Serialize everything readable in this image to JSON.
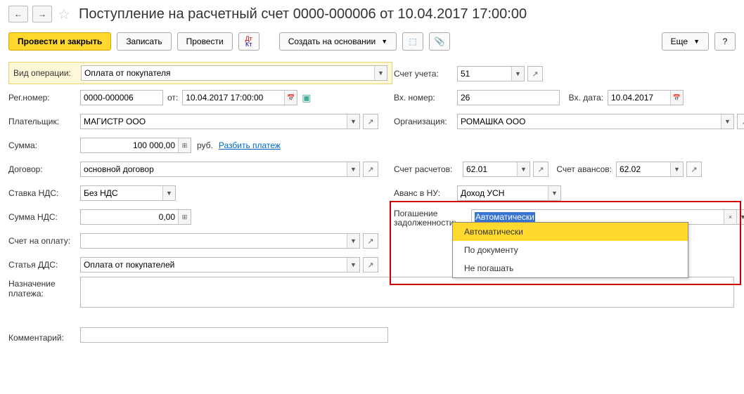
{
  "header": {
    "title": "Поступление на расчетный счет 0000-000006 от 10.04.2017 17:00:00"
  },
  "toolbar": {
    "post_close": "Провести и закрыть",
    "save": "Записать",
    "post": "Провести",
    "create_basis": "Создать на основании",
    "more": "Еще"
  },
  "labels": {
    "vid_op": "Вид операции:",
    "schet_ucheta": "Счет учета:",
    "reg_nomer": "Рег.номер:",
    "ot": "от:",
    "vh_nomer": "Вх. номер:",
    "vh_data": "Вх. дата:",
    "platelshik": "Плательщик:",
    "organizaciya": "Организация:",
    "summa": "Сумма:",
    "rub": "руб.",
    "razbit": "Разбить платеж",
    "dogovor": "Договор:",
    "schet_rasch": "Счет расчетов:",
    "schet_avans": "Счет авансов:",
    "stavka_nds": "Ставка НДС:",
    "avans_nu": "Аванс в НУ:",
    "summa_nds": "Сумма НДС:",
    "pogashenie": "Погашение задолженности:",
    "schet_oplatu": "Счет на оплату:",
    "statya_dds": "Статья ДДС:",
    "naznachenie": "Назначение платежа:",
    "kommentariy": "Комментарий:"
  },
  "values": {
    "vid_op": "Оплата от покупателя",
    "schet_ucheta": "51",
    "reg_nomer": "0000-000006",
    "ot": "10.04.2017 17:00:00",
    "vh_nomer": "26",
    "vh_data": "10.04.2017",
    "platelshik": "МАГИСТР ООО",
    "organizaciya": "РОМАШКА ООО",
    "summa": "100 000,00",
    "dogovor": "основной договор",
    "schet_rasch": "62.01",
    "schet_avans": "62.02",
    "stavka_nds": "Без НДС",
    "avans_nu": "Доход УСН",
    "summa_nds": "0,00",
    "pogashenie": "Автоматически",
    "schet_oplatu": "",
    "statya_dds": "Оплата от покупателей",
    "naznachenie": "",
    "kommentariy": ""
  },
  "dropdown": {
    "opt1": "Автоматически",
    "opt2": "По документу",
    "opt3": "Не погашать"
  }
}
